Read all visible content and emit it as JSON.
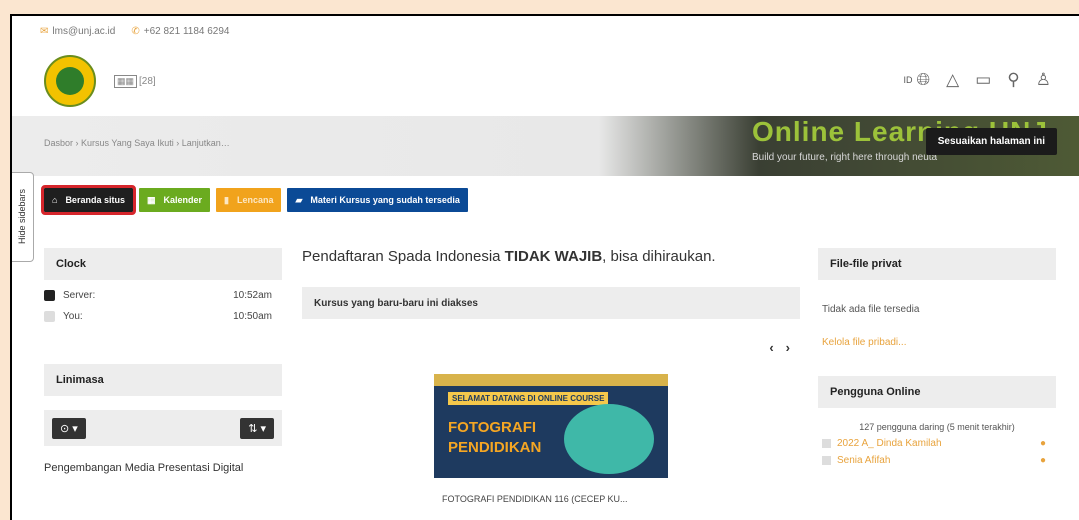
{
  "topbar": {
    "email": "lms@unj.ac.id",
    "phone": "+62 821 1184 6294"
  },
  "header": {
    "course_count": "[28]",
    "lang": "ID",
    "icons": [
      "globe-icon",
      "bell-icon",
      "message-icon",
      "search-icon",
      "user-icon"
    ]
  },
  "banner": {
    "breadcrumb": "Dasbor › Kursus Yang Saya Ikuti › Lanjutkan…",
    "title": "Online Learning UNJ",
    "subtitle": "Build your future, right here through neuta",
    "customize": "Sesuaikan halaman ini"
  },
  "sidebar_toggle": "Hide sidebars",
  "quicklinks": {
    "home": "Beranda situs",
    "calendar": "Kalender",
    "badges": "Lencana",
    "materials": "Materi Kursus yang sudah tersedia"
  },
  "clock": {
    "title": "Clock",
    "server_label": "Server:",
    "server_time": "10:52am",
    "you_label": "You:",
    "you_time": "10:50am"
  },
  "timeline": {
    "title": "Linimasa",
    "course": "Pengembangan Media Presentasi Digital"
  },
  "main": {
    "notice_prefix": "Pendaftaran Spada Indonesia ",
    "notice_bold": "TIDAK WAJIB",
    "notice_suffix": ", bisa dihiraukan.",
    "recent_title": "Kursus yang baru-baru ini diakses",
    "course_image": {
      "welcome": "SELAMAT DATANG DI ONLINE COURSE",
      "title_line1": "FOTOGRAFI",
      "title_line2": "PENDIDIKAN"
    },
    "course_name": "FOTOGRAFI PENDIDIKAN 116 (CECEP KU..."
  },
  "private_files": {
    "title": "File-file privat",
    "empty": "Tidak ada file tersedia",
    "manage": "Kelola file pribadi..."
  },
  "online_users": {
    "title": "Pengguna Online",
    "count": "127 pengguna daring (5 menit terakhir)",
    "users": [
      "2022 A_ Dinda Kamilah",
      "Senia Afifah"
    ]
  },
  "colors": {
    "home": "#1f1f1f",
    "calendar": "#6bab1f",
    "badges": "#f1a31c",
    "materials": "#0b4a96",
    "link": "#e8a33d",
    "highlight": "#d6262c"
  }
}
